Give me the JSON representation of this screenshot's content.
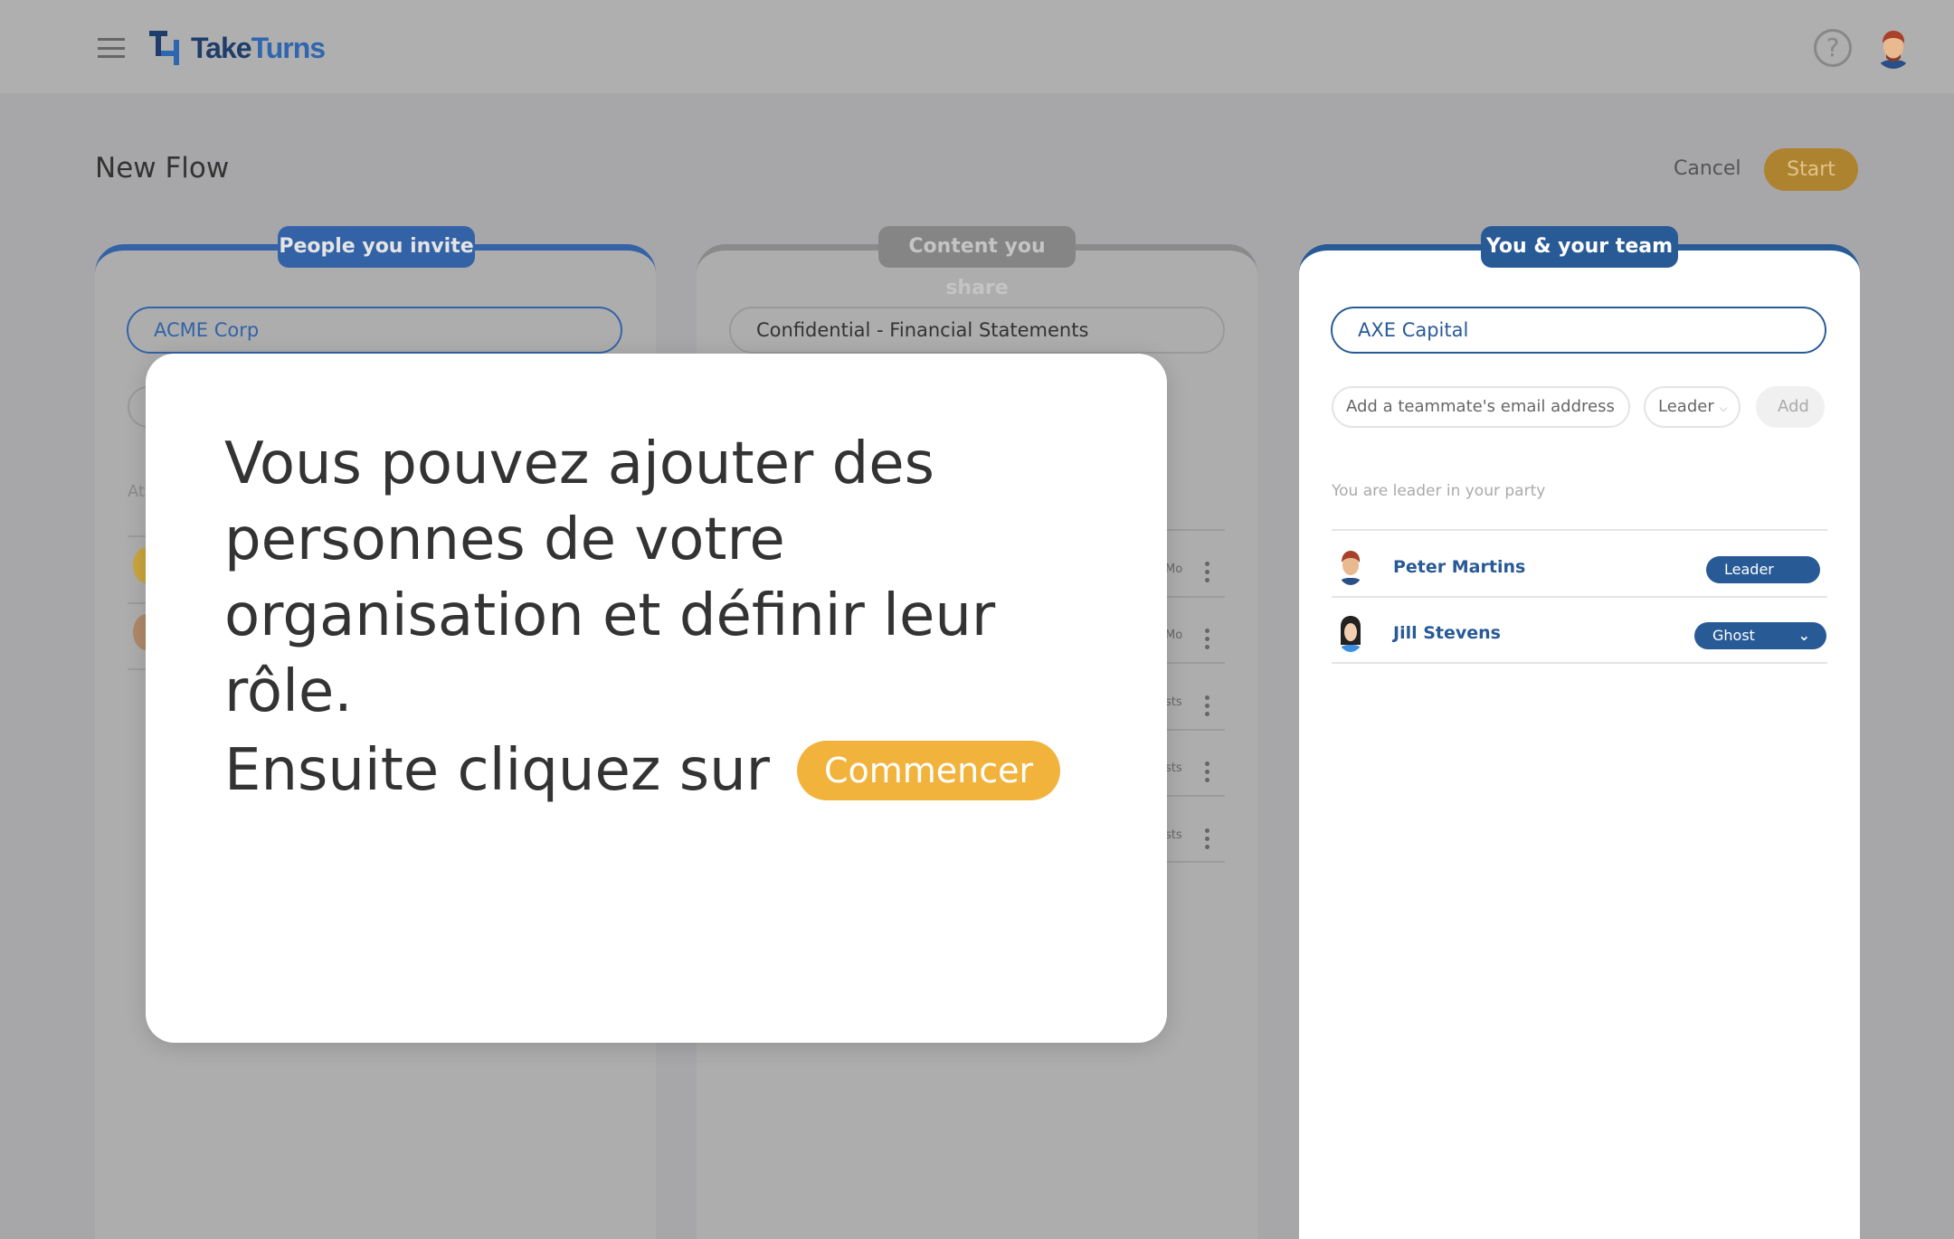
{
  "header": {
    "logo": {
      "part1": "Take",
      "part2": "Turns"
    },
    "help_icon": "question-circle-icon",
    "menu_icon": "hamburger-icon"
  },
  "page": {
    "title": "New Flow",
    "cancel_label": "Cancel",
    "start_label": "Start"
  },
  "panels": {
    "invite": {
      "tab": "People you invite",
      "company": "ACME Corp",
      "partial_label": "At"
    },
    "content": {
      "tab": "Content you share",
      "title": "Confidential - Financial Statements",
      "row_tails": [
        "Mo",
        "Mo",
        "sts",
        "sts",
        "sts"
      ]
    },
    "team": {
      "tab": "You & your team",
      "company": "AXE Capital",
      "email_placeholder": "Add a teammate's email address",
      "role_select": "Leader",
      "add_label": "Add",
      "info": "You are leader in your party",
      "members": [
        {
          "name": "Peter Martins",
          "role": "Leader"
        },
        {
          "name": "Jill Stevens",
          "role": "Ghost"
        }
      ]
    }
  },
  "modal": {
    "text": "Vous pouvez ajouter des personnes de votre organisation et définir leur rôle.",
    "then": "Ensuite cliquez sur",
    "button": "Commencer"
  },
  "colors": {
    "brand_blue": "#285a96",
    "accent_amber": "#f2b33d"
  }
}
